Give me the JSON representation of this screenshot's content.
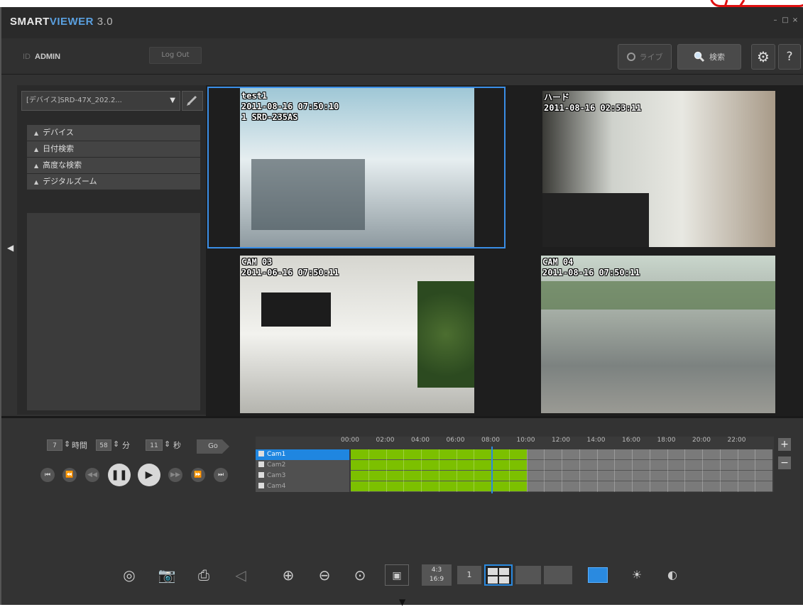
{
  "app": {
    "logo_part1": "SMART",
    "logo_part2": "VIEWER",
    "logo_part3": "3.0"
  },
  "header": {
    "user_prefix": "ID",
    "user_name": "ADMIN",
    "logout_label": "Log Out",
    "live_label": "ライブ",
    "search_label": "検索",
    "help_label": "?"
  },
  "sidebar": {
    "device_select": "[デバイス]SRD-47X_202.2...",
    "menu": [
      {
        "label": "デバイス"
      },
      {
        "label": "日付検索"
      },
      {
        "label": "高度な検索"
      },
      {
        "label": "デジタルズーム"
      }
    ]
  },
  "cameras": [
    {
      "line1": "test1",
      "line2": "2011-08-16 07:50:10",
      "line3": "1 SRD-235AS"
    },
    {
      "line1": "ハード",
      "line2": "2011-08-16 02:53:11",
      "line3": ""
    },
    {
      "line1": "CAM 03",
      "line2": "2011-06-16 07:50:11",
      "line3": ""
    },
    {
      "line1": "CAM 04",
      "line2": "2011-08-16 07:50:11",
      "line3": ""
    }
  ],
  "playback": {
    "hour_value": "7",
    "hour_label": "時間",
    "minute_value": "58",
    "minute_label": "分",
    "second_value": "11",
    "second_label": "秒",
    "go_label": "Go"
  },
  "timeline": {
    "hours": [
      "00:00",
      "02:00",
      "04:00",
      "06:00",
      "08:00",
      "10:00",
      "12:00",
      "14:00",
      "16:00",
      "18:00",
      "20:00",
      "22:00"
    ],
    "rows": [
      {
        "name": "Cam1",
        "selected": true
      },
      {
        "name": "Cam2",
        "selected": false
      },
      {
        "name": "Cam3",
        "selected": false
      },
      {
        "name": "Cam4",
        "selected": false
      }
    ],
    "recorded_start_hour": 0,
    "recorded_end_hour": 10,
    "cursor_hour": 8,
    "recording_color": "#7cc000",
    "cursor_color": "#2a8ae0"
  },
  "toolbar": {
    "ratio_top": "4:3",
    "ratio_bottom": "16:9",
    "layout_one": "1"
  },
  "colors": {
    "highlight": "#e01010",
    "accent": "#2a8ae0"
  }
}
